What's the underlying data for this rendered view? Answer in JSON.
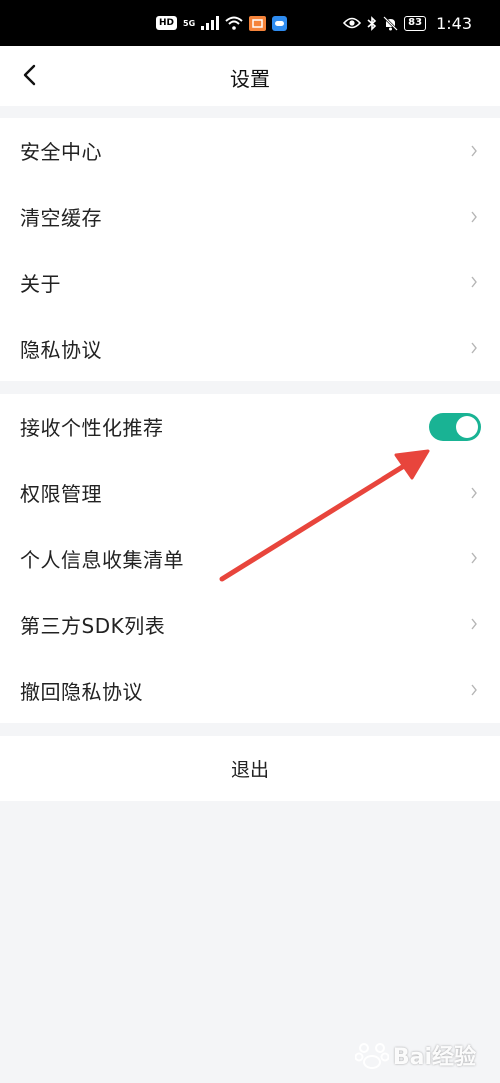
{
  "status_bar": {
    "hd_badge": "HD",
    "network": "5G",
    "battery": "83",
    "time": "1:43"
  },
  "header": {
    "title": "设置"
  },
  "group1": {
    "items": [
      {
        "label": "安全中心"
      },
      {
        "label": "清空缓存"
      },
      {
        "label": "关于"
      },
      {
        "label": "隐私协议"
      }
    ]
  },
  "group2": {
    "toggle_item": {
      "label": "接收个性化推荐",
      "enabled": true
    },
    "items": [
      {
        "label": "权限管理"
      },
      {
        "label": "个人信息收集清单"
      },
      {
        "label": "第三方SDK列表"
      },
      {
        "label": "撤回隐私协议"
      }
    ]
  },
  "logout": {
    "label": "退出"
  },
  "colors": {
    "toggle_on": "#19b394",
    "annotation_arrow": "#e8453c",
    "background": "#f4f5f7"
  },
  "watermark": {
    "text": "Bai经验"
  }
}
